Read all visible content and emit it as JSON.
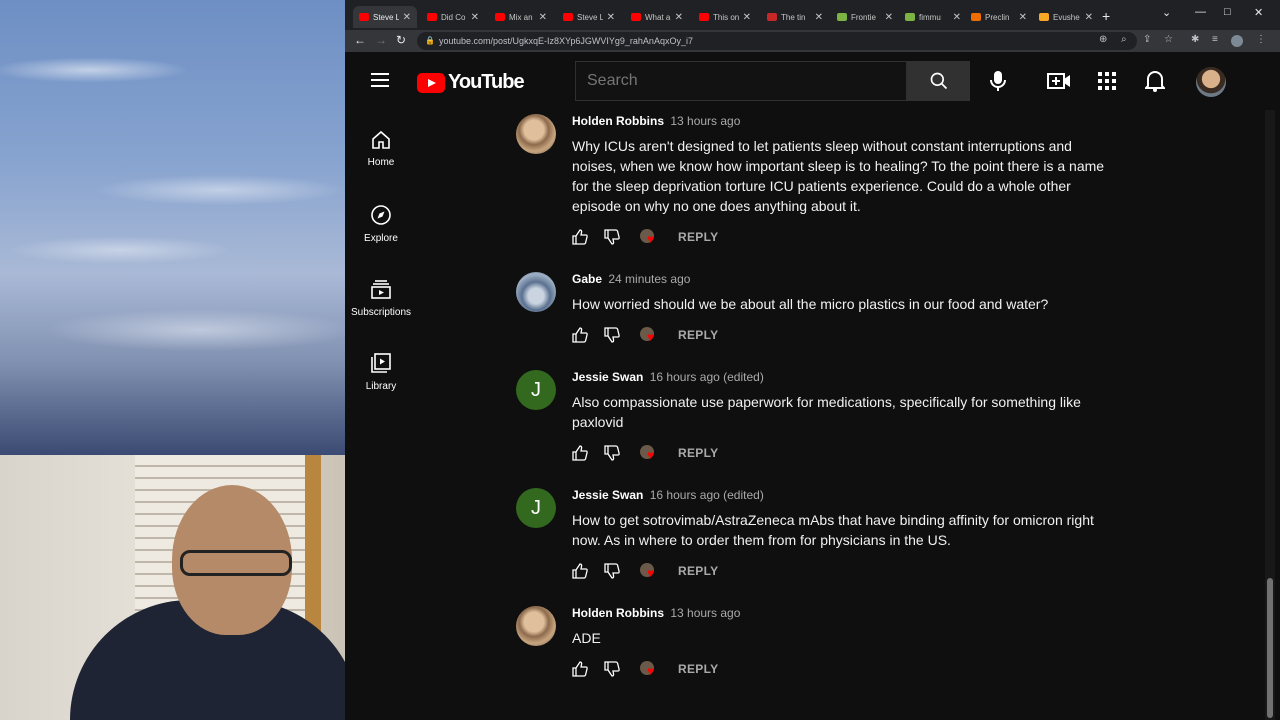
{
  "browser": {
    "tabs": [
      {
        "label": "Steve L",
        "fav": "#ff0000",
        "active": true
      },
      {
        "label": "Did Co",
        "fav": "#ff0000"
      },
      {
        "label": "Mix an",
        "fav": "#ff0000"
      },
      {
        "label": "Steve L",
        "fav": "#ff0000"
      },
      {
        "label": "What a",
        "fav": "#ff0000"
      },
      {
        "label": "This on",
        "fav": "#ff0000"
      },
      {
        "label": "The tin",
        "fav": "#c62828"
      },
      {
        "label": "Frontie",
        "fav": "#7cb342"
      },
      {
        "label": "fimmu",
        "fav": "#7cb342"
      },
      {
        "label": "Preclin",
        "fav": "#ef6c00"
      },
      {
        "label": "Evushe",
        "fav": "#f9a825"
      }
    ],
    "url": "youtube.com/post/UgkxqE-Iz8XYp6JGWVIYg9_rahAnAqxOy_i7"
  },
  "header": {
    "logo_text": "YouTube",
    "search_placeholder": "Search"
  },
  "sidebar": {
    "items": [
      {
        "label": "Home",
        "icon": "home-icon"
      },
      {
        "label": "Explore",
        "icon": "compass-icon"
      },
      {
        "label": "Subscriptions",
        "icon": "subscriptions-icon"
      },
      {
        "label": "Library",
        "icon": "library-icon"
      }
    ]
  },
  "comments": [
    {
      "author": "Holden Robbins",
      "time": "13 hours ago",
      "avatar": "photo1",
      "text": "Why ICUs aren't designed to let patients sleep without constant interruptions and noises, when we know how important sleep is to healing? To the point there is a name for the sleep deprivation torture ICU patients experience.  Could do a whole other episode on why no one does anything about it.",
      "reply": "REPLY"
    },
    {
      "author": "Gabe",
      "time": "24 minutes ago",
      "avatar": "photo2",
      "text": "How worried should we be about all the micro plastics in our food and water?",
      "reply": "REPLY"
    },
    {
      "author": "Jessie Swan",
      "time": "16 hours ago (edited)",
      "avatar": "letter",
      "letter": "J",
      "text": "Also compassionate use paperwork for medications, specifically for something like paxlovid",
      "reply": "REPLY"
    },
    {
      "author": "Jessie Swan",
      "time": "16 hours ago (edited)",
      "avatar": "letter",
      "letter": "J",
      "text": "How to get sotrovimab/AstraZeneca mAbs that have binding affinity for omicron right now. As in where to order them from for physicians in the US.",
      "reply": "REPLY"
    },
    {
      "author": "Holden Robbins",
      "time": "13 hours ago",
      "avatar": "photo1",
      "text": "ADE",
      "reply": "REPLY"
    }
  ],
  "colors": {
    "brand_red": "#ff0000",
    "background": "#0f0f0f",
    "text_primary": "#f1f1f1",
    "text_secondary": "#aaaaaa"
  }
}
